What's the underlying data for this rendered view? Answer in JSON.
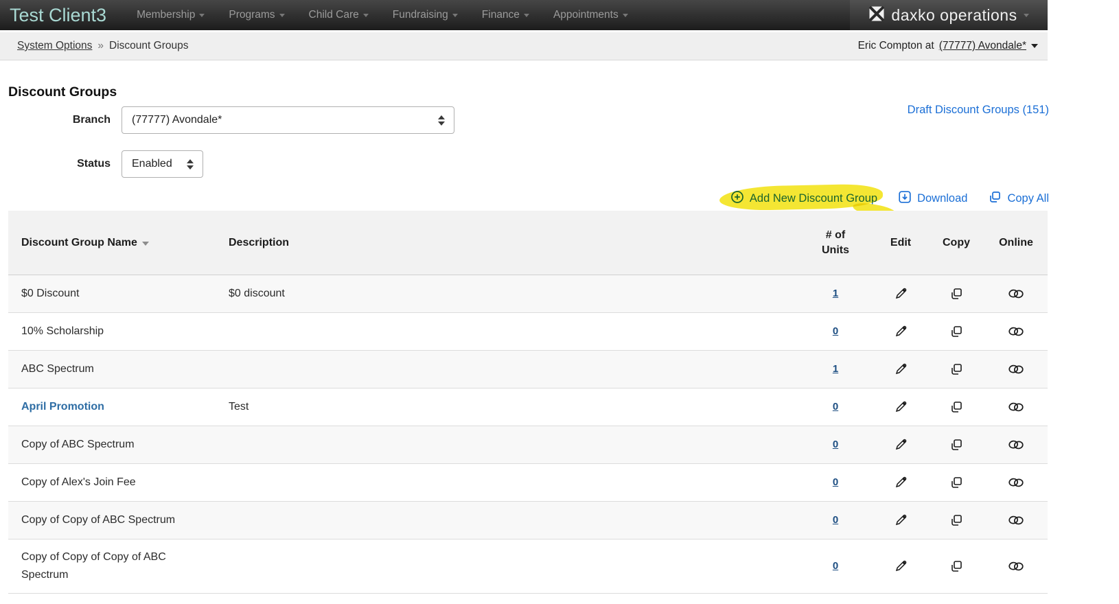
{
  "nav": {
    "brand": "Test Client3",
    "items": [
      {
        "label": "Membership"
      },
      {
        "label": "Programs"
      },
      {
        "label": "Child Care"
      },
      {
        "label": "Fundraising"
      },
      {
        "label": "Finance"
      },
      {
        "label": "Appointments"
      }
    ],
    "logo_text": "daxko operations"
  },
  "breadcrumb": {
    "link": "System Options",
    "separator": "»",
    "current": "Discount Groups",
    "user_prefix": "Eric Compton at",
    "user_branch": "(77777) Avondale*"
  },
  "page": {
    "title": "Discount Groups"
  },
  "filters": {
    "branch_label": "Branch",
    "branch_value": "(77777) Avondale*",
    "status_label": "Status",
    "status_value": "Enabled"
  },
  "links": {
    "draft": "Draft Discount Groups (151)",
    "add_new": "Add New Discount Group",
    "download": "Download",
    "copy_all": "Copy All"
  },
  "icons": {
    "add_new": "plus-circle-icon",
    "download": "download-icon",
    "copy_all": "copy-icon",
    "row_edit": "pencil-icon",
    "row_copy": "copy-icon",
    "row_online": "chain-link-icon",
    "logo": "daxko-x-icon"
  },
  "table": {
    "headers": {
      "name": "Discount Group Name",
      "description": "Description",
      "units": "# of Units",
      "edit": "Edit",
      "copy": "Copy",
      "online": "Online"
    },
    "rows": [
      {
        "name": "$0 Discount",
        "description": "$0 discount",
        "units": "1",
        "name_is_link": false
      },
      {
        "name": "10% Scholarship",
        "description": "",
        "units": "0",
        "name_is_link": false
      },
      {
        "name": "ABC Spectrum",
        "description": "",
        "units": "1",
        "name_is_link": false
      },
      {
        "name": "April Promotion",
        "description": "Test",
        "units": "0",
        "name_is_link": true
      },
      {
        "name": "Copy of ABC Spectrum",
        "description": "",
        "units": "0",
        "name_is_link": false
      },
      {
        "name": "Copy of Alex's Join Fee",
        "description": "",
        "units": "0",
        "name_is_link": false
      },
      {
        "name": "Copy of Copy of ABC Spectrum",
        "description": "",
        "units": "0",
        "name_is_link": false
      },
      {
        "name": "Copy of Copy of Copy of ABC Spectrum",
        "description": "",
        "units": "0",
        "name_is_link": false
      }
    ]
  },
  "colors": {
    "accent_blue": "#1b6fd6",
    "units_blue": "#1d4e82",
    "row_link_blue": "#2e6da4",
    "highlight_yellow": "#f2e105",
    "brand_teal": "#a9d9d3",
    "nav_dark": "#1c1c1c",
    "header_gray": "#f2f2f2",
    "stripe_gray": "#f8f8f8"
  }
}
